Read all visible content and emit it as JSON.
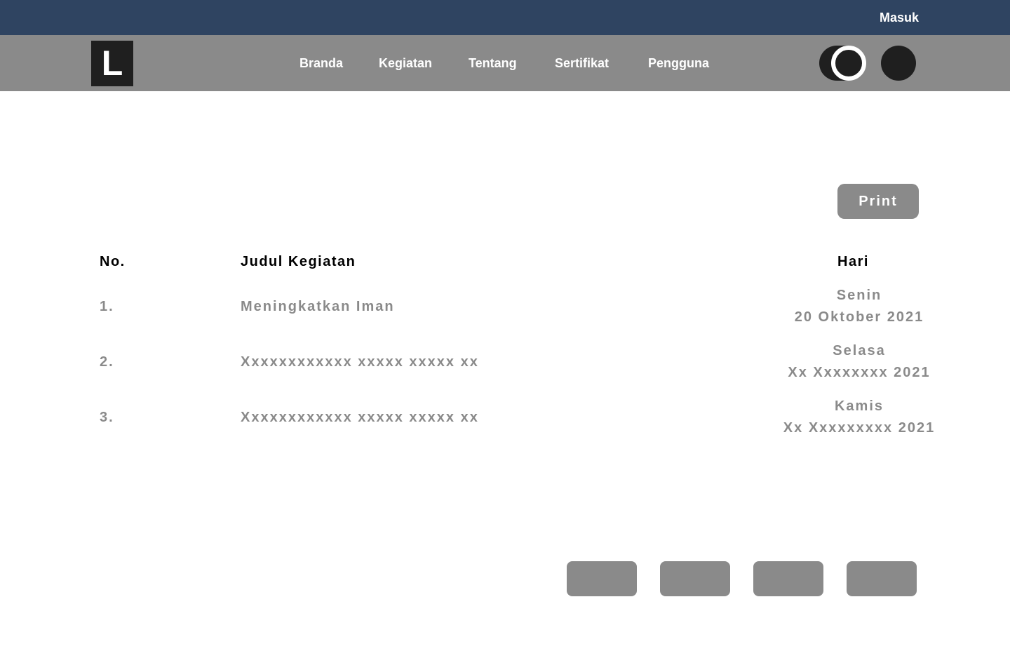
{
  "topbar": {
    "login_label": "Masuk"
  },
  "logo": {
    "letter": "L"
  },
  "nav": {
    "items": [
      {
        "label": "Branda"
      },
      {
        "label": "Kegiatan"
      },
      {
        "label": "Tentang"
      },
      {
        "label": "Sertifikat"
      },
      {
        "label": "Pengguna"
      }
    ]
  },
  "icons": {
    "theme_toggle": "toggle-switch-icon",
    "profile": "avatar-icon"
  },
  "colors": {
    "topbar": "#2f4461",
    "navbar": "#8a8a8a",
    "dark": "#1f1f1f",
    "muted_text": "#8a8a8a"
  },
  "actions": {
    "print_label": "Print"
  },
  "table": {
    "headers": {
      "no": "No.",
      "title": "Judul Kegiatan",
      "day": "Hari"
    },
    "rows": [
      {
        "no": "1.",
        "title": "Meningkatkan Iman",
        "day": "Senin",
        "date": "20 Oktober 2021"
      },
      {
        "no": "2.",
        "title": "Xxxxxxxxxxxx xxxxx xxxxx xx",
        "day": "Selasa",
        "date": "Xx Xxxxxxxx 2021"
      },
      {
        "no": "3.",
        "title": "Xxxxxxxxxxxx xxxxx xxxxx xx",
        "day": "Kamis",
        "date": "Xx Xxxxxxxxx 2021"
      }
    ]
  },
  "pagination": {
    "button_count": 4
  }
}
